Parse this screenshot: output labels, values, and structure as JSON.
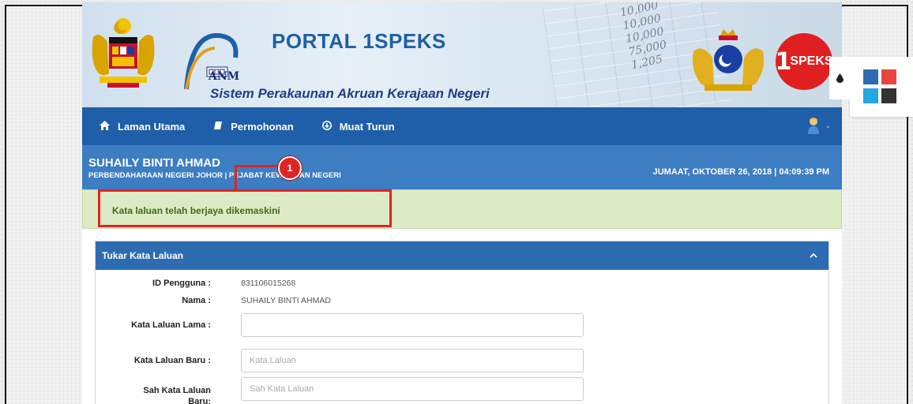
{
  "banner": {
    "title": "PORTAL 1SPEKS",
    "subtitle": "Sistem Perakaunan Akruan Kerajaan Negeri",
    "anm_text": "ANM",
    "speks_logo_text": "SPEKS",
    "speks_logo_number": "1",
    "background_numbers": [
      "10,000",
      "10,000",
      "10,000",
      "75,000",
      "1,205"
    ]
  },
  "nav": {
    "items": [
      {
        "label": "Laman Utama",
        "icon": "home-icon"
      },
      {
        "label": "Permohonan",
        "icon": "book-icon"
      },
      {
        "label": "Muat Turun",
        "icon": "download-icon"
      }
    ],
    "user_icon": "user-avatar-icon"
  },
  "user": {
    "name": "SUHAILY BINTI AHMAD",
    "department": "PERBENDAHARAAN NEGERI JOHOR | PEJABAT KEWANGAN NEGERI",
    "datetime": "JUMAAT, OKTOBER 26, 2018 | 04:09:39 PM"
  },
  "alert": {
    "message": "Kata laluan telah berjaya dikemaskini"
  },
  "annotation": {
    "number": "1"
  },
  "panel": {
    "title": "Tukar Kata Laluan",
    "id_label": "ID Pengguna :",
    "id_value": "831106015268",
    "name_label": "Nama :",
    "name_value": "SUHAILY BINTI AHMAD",
    "old_password_label": "Kata Laluan Lama :",
    "old_password_value": "",
    "new_password_label": "Kata Laluan Baru :",
    "new_password_placeholder": "Kata Laluan",
    "confirm_password_label_1": "Sah Kata Laluan",
    "confirm_password_label_2": "Baru:",
    "confirm_password_placeholder": "Sah Kata Laluan"
  },
  "theme": {
    "colors": [
      "#2e6cb2",
      "#e8463a",
      "#22a7e0",
      "#333333"
    ]
  }
}
